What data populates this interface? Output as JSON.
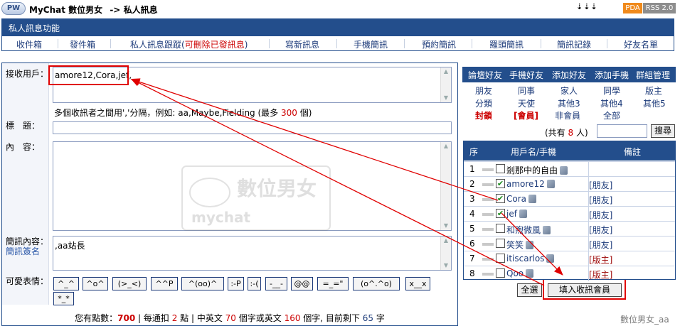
{
  "header": {
    "logo": "PW",
    "title": "MyChat 數位男女",
    "breadcrumb_sep": "->",
    "section": "私人訊息",
    "dots": "⇣⇣⇣",
    "pda": "PDA",
    "rss": "RSS 2.0"
  },
  "funcbar": {
    "title": "私人訊息功能"
  },
  "nav": {
    "items": [
      {
        "label": "收件箱"
      },
      {
        "label": "發件箱"
      },
      {
        "label": "私人訊息跟蹤(",
        "warn": "可刪除已發訊息",
        "tail": ")"
      },
      {
        "label": "寫新訊息"
      },
      {
        "label": "手機簡訊"
      },
      {
        "label": "預約簡訊"
      },
      {
        "label": "羅頭簡訊"
      },
      {
        "label": "簡訊記錄"
      },
      {
        "label": "好友名單"
      }
    ]
  },
  "form": {
    "recipients_label": "接收用戶：",
    "recipients_value": "amore12,Cora,jef,",
    "hint_prefix": "多個收訊者之間用','分隔，例如: aa,Maybe,Fielding (最多 ",
    "hint_max": "300",
    "hint_suffix": " 個)",
    "subject_label": "標　題：",
    "subject_value": "",
    "content_label": "內　容：",
    "content_value": "",
    "sms_label": "簡訊內容：",
    "sms_sign_label": "簡訊簽名",
    "sms_value": ",aa站長",
    "emoticons_label": "可愛表情：",
    "emoticons": [
      "^_^",
      "^o^",
      "(>_<)",
      "^^P",
      "^(oo)^",
      ":-P",
      ":-(",
      "-__-",
      "@@",
      "=_=\"",
      "(o^.^o)",
      "x__x",
      "*_*"
    ]
  },
  "points": {
    "prefix": "您有點數：",
    "points": "700",
    "per_notify_prefix": " | 每通扣 ",
    "per_notify": "2",
    "per_notify_unit": " 點 | 中英文 ",
    "cn_limit": "70",
    "cn_unit": " 個字或英文 ",
    "en_limit": "160",
    "en_unit": " 個字, 目前剩下 ",
    "remaining": "65",
    "remaining_unit": " 字"
  },
  "right": {
    "tabs": [
      "論壇好友",
      "手機好友",
      "添加好友",
      "添加手機",
      "群組管理"
    ],
    "groups_row1": [
      "朋友",
      "同事",
      "家人",
      "同學",
      "版主"
    ],
    "groups_row2": [
      "分類",
      "天使",
      "其他3",
      "其他4",
      "其他5"
    ],
    "groups_row3": [
      "封鎖",
      "[會員]",
      "非會員",
      "全部"
    ],
    "count_prefix": "(共有 ",
    "count": "8",
    "count_suffix": " 人)",
    "search_button": "搜尋",
    "table_headers": [
      "序",
      "用戶名/手機",
      "備註"
    ],
    "users": [
      {
        "num": "1",
        "name": "剎那中的自由",
        "checked": false,
        "note": "",
        "note_red": false,
        "black": true
      },
      {
        "num": "2",
        "name": "amore12",
        "checked": true,
        "note": "[朋友]",
        "note_red": false,
        "black": false
      },
      {
        "num": "3",
        "name": "Cora",
        "checked": true,
        "note": "[朋友]",
        "note_red": false,
        "black": false
      },
      {
        "num": "4",
        "name": "jef",
        "checked": true,
        "note": "[朋友]",
        "note_red": false,
        "black": false
      },
      {
        "num": "5",
        "name": "和煦微風",
        "checked": false,
        "note": "[朋友]",
        "note_red": false,
        "black": false
      },
      {
        "num": "6",
        "name": "笑笑",
        "checked": false,
        "note": "[朋友]",
        "note_red": false,
        "black": false
      },
      {
        "num": "7",
        "name": "itiscarlos",
        "checked": false,
        "note": "[版主]",
        "note_red": true,
        "black": false
      },
      {
        "num": "8",
        "name": "Qoo",
        "checked": false,
        "note": "[版主]",
        "note_red": true,
        "black": false
      }
    ],
    "select_all": "全選",
    "fill_button": "填入收訊會員"
  },
  "footer": {
    "watermark": "數位男女_aa"
  },
  "watermark_logo": {
    "line1": "數位男女",
    "line2": "mychat"
  },
  "accent": {
    "navy": "#234e8c",
    "red": "#e00000"
  }
}
